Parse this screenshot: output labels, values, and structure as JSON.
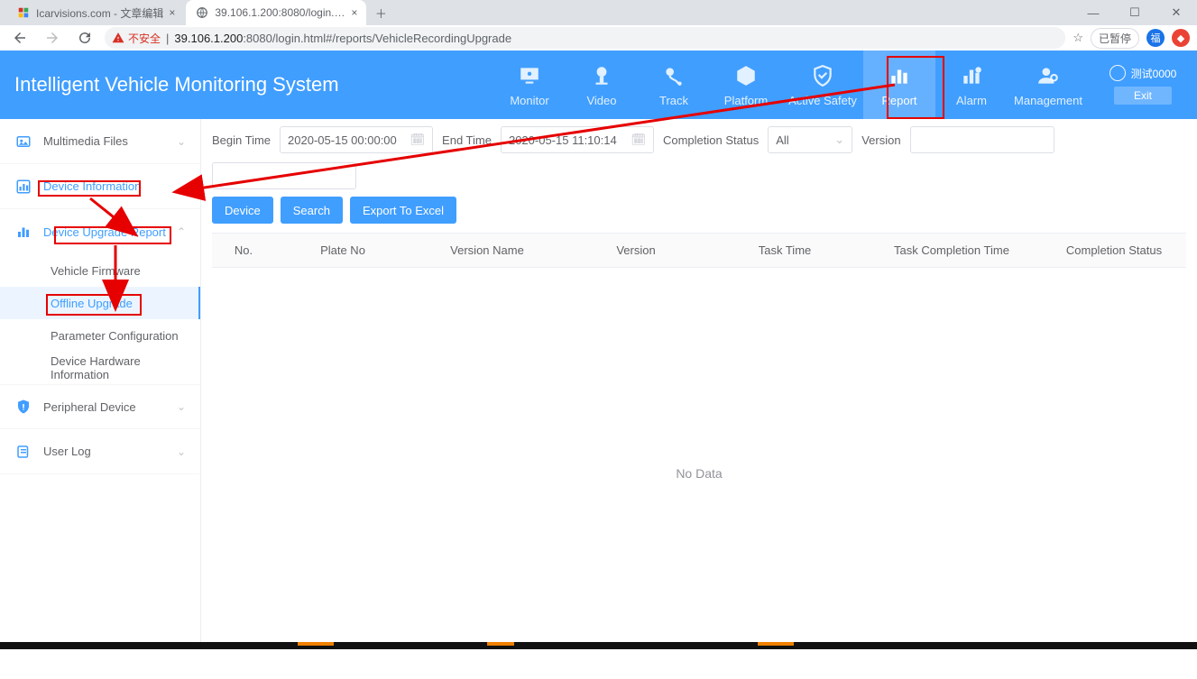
{
  "browser": {
    "tabs": [
      {
        "title": "Icarvisions.com - 文章编辑"
      },
      {
        "title": "39.106.1.200:8080/login.html#"
      }
    ],
    "insecure_label": "不安全",
    "url_prefix": "39.106.1.200",
    "url_port": ":8080",
    "url_path": "/login.html#/reports/VehicleRecordingUpgrade",
    "pause_label": "已暂停"
  },
  "header": {
    "title": "Intelligent Vehicle Monitoring System",
    "nav": {
      "monitor": "Monitor",
      "video": "Video",
      "track": "Track",
      "platform": "Platform",
      "active_safety": "Active Safety",
      "report": "Report",
      "alarm": "Alarm",
      "management": "Management"
    },
    "username": "测试0000",
    "exit": "Exit"
  },
  "sidebar": {
    "multimedia": "Multimedia Files",
    "device_info": "Device Information",
    "device_upgrade_report": "Device Upgrade Report",
    "items": {
      "vehicle_firmware": "Vehicle Firmware",
      "offline_upgrade": "Offline Upgrade",
      "parameter_configuration": "Parameter Configuration",
      "device_hardware_info": "Device Hardware Information"
    },
    "peripheral_device": "Peripheral Device",
    "user_log": "User Log"
  },
  "filters": {
    "begin_time_label": "Begin Time",
    "begin_time_value": "2020-05-15 00:00:00",
    "end_time_label": "End Time",
    "end_time_value": "2020-05-15 11:10:14",
    "completion_status_label": "Completion Status",
    "completion_status_value": "All",
    "version_label": "Version"
  },
  "buttons": {
    "device": "Device",
    "search": "Search",
    "export": "Export To Excel"
  },
  "table": {
    "columns": {
      "no": "No.",
      "plate_no": "Plate No",
      "version_name": "Version Name",
      "version": "Version",
      "task_time": "Task Time",
      "task_completion_time": "Task Completion Time",
      "completion_status": "Completion Status"
    },
    "no_data": "No Data"
  }
}
